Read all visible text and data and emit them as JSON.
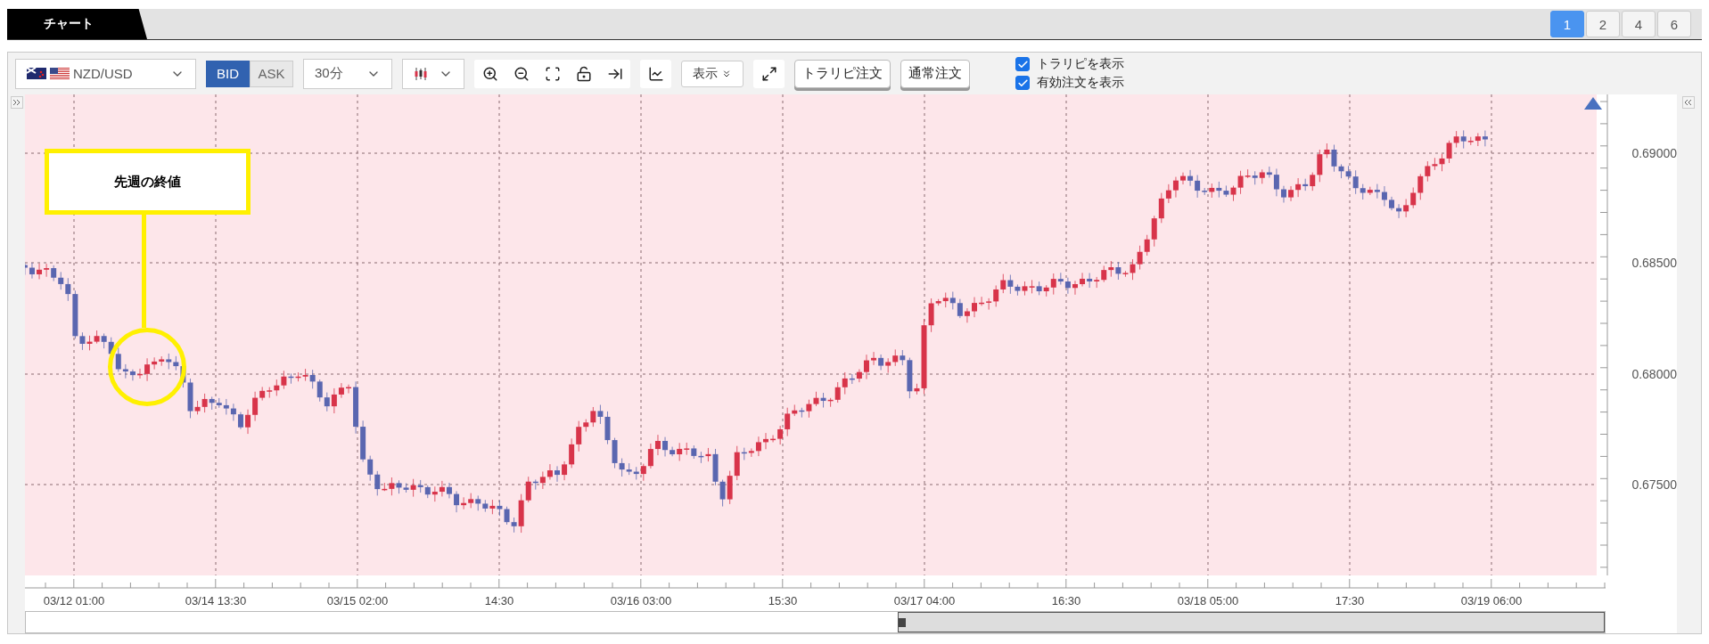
{
  "tab": {
    "label": "チャート",
    "selected": true
  },
  "layouts": [
    {
      "label": "1",
      "selected": true
    },
    {
      "label": "2",
      "selected": false
    },
    {
      "label": "4",
      "selected": false
    },
    {
      "label": "6",
      "selected": false
    }
  ],
  "toolbar": {
    "symbol": "NZD/USD",
    "price_side": [
      {
        "label": "BID",
        "selected": true
      },
      {
        "label": "ASK",
        "selected": false
      }
    ],
    "interval": "30分",
    "display_button": "表示",
    "order_buttons": [
      "トラリピ注文",
      "通常注文"
    ],
    "checkboxes": [
      {
        "label": "トラリピを表示",
        "checked": true
      },
      {
        "label": "有効注文を表示",
        "checked": true
      }
    ]
  },
  "chart": {
    "y_labels": [
      "0.69000",
      "0.68500",
      "0.68000",
      "0.67500"
    ],
    "x_labels": [
      "03/12 01:00",
      "03/14 13:30",
      "03/15 02:00",
      "14:30",
      "03/16 03:00",
      "15:30",
      "03/17 04:00",
      "16:30",
      "03/18 05:00",
      "17:30",
      "03/19 06:00"
    ],
    "annotation": "先週の終値"
  }
}
